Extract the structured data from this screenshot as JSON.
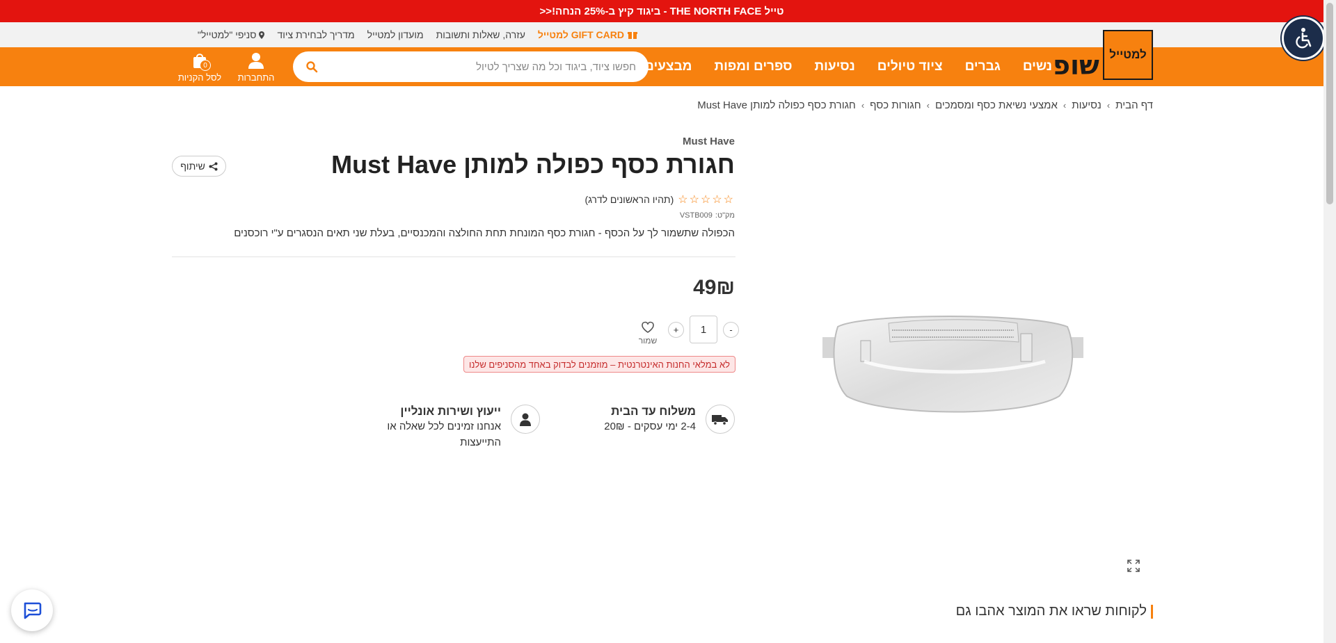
{
  "promo_bar": {
    "text": "טייל THE NORTH FACE - ביגוד קיץ ב-25% הנחה!<<"
  },
  "utility_bar": {
    "gift_card": "GIFT CARD למטייל",
    "links": [
      "עזרה, שאלות ותשובות",
      "מועדון למטייל",
      "מדריך לבחירת ציוד"
    ],
    "stores": "סניפי \"למטייל\""
  },
  "header": {
    "logo_text": "למטייל",
    "shop_word": "שופ",
    "nav": [
      "נשים",
      "גברים",
      "ציוד טיולים",
      "נסיעות",
      "ספרים ומפות",
      "מבצעים"
    ],
    "search_placeholder": "חפשו ציוד, ביגוד וכל מה שצריך לטיול",
    "login_label": "התחברות",
    "cart_label": "לסל הקניות",
    "cart_count": "0"
  },
  "breadcrumb": [
    "דף הבית",
    "נסיעות",
    "אמצעי נשיאת כסף ומסמכים",
    "חגורות כסף",
    "חגורת כסף כפולה למותן Must Have"
  ],
  "product": {
    "brand": "Must Have",
    "title": "חגורת כסף כפולה למותן Must Have",
    "share_label": "שיתוף",
    "rating_stars": "☆☆☆☆☆",
    "rating_text": "(תהיו הראשונים לדרג)",
    "sku_label": "מק\"ט:",
    "sku_value": "VSTB009",
    "description": "הכפולה שתשמור לך על הכסף - חגורת כסף המונחת תחת החולצה והמכנסיים, בעלת שני תאים הנסגרים ע\"י רוכסנים",
    "price": "49₪",
    "quantity": "1",
    "minus_label": "-",
    "plus_label": "+",
    "save_label": "שמור",
    "stock_notice": "לא במלאי החנות האינטרנטית – מוזמנים לבדוק באחד מהסניפים שלנו"
  },
  "features": {
    "shipping": {
      "title": "משלוח עד הבית",
      "subtitle": "2-4 ימי עסקים - 20₪"
    },
    "support": {
      "title": "ייעוץ ושירות אונליין",
      "line1": "אנחנו זמינים לכל שאלה או",
      "line2": "התייעצות"
    }
  },
  "related_title": "לקוחות שראו את המוצר אהבו גם",
  "colors": {
    "accent": "#f7810f",
    "promo": "#e3140f",
    "access": "#1c2d4a"
  }
}
